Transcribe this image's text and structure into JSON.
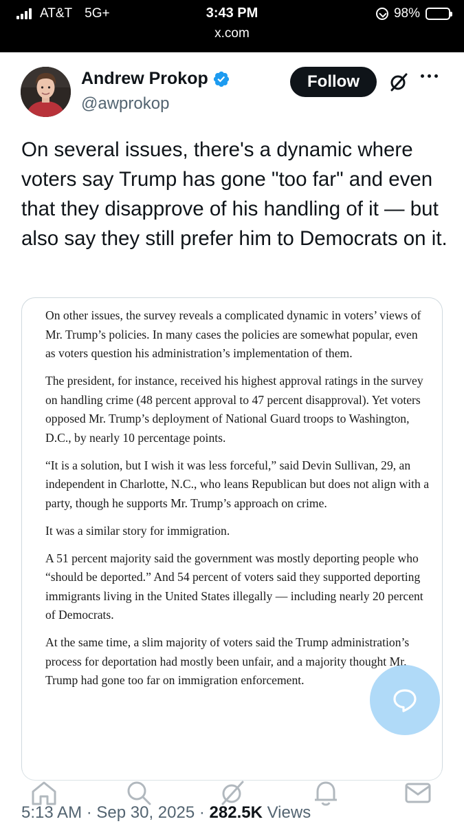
{
  "status_bar": {
    "carrier": "AT&T",
    "network": "5G+",
    "time": "3:43 PM",
    "battery": "98%",
    "battery_level": 0.98
  },
  "url_bar": {
    "domain": "x.com"
  },
  "tweet": {
    "author_name": "Andrew Prokop",
    "author_handle": "@awprokop",
    "follow_label": "Follow",
    "text": "On several issues, there's a dynamic where voters say Trump has gone \"too far\" and even that they disapprove of his handling of it — but also say they still prefer him to Democrats on it.",
    "time": "5:13 AM",
    "date": "Sep 30, 2025",
    "views_count": "282.5K",
    "views_label": "Views"
  },
  "article_image": {
    "paragraphs": [
      "On other issues, the survey reveals a complicated dynamic in voters’ views of Mr. Trump’s policies. In many cases the policies are somewhat popular, even as voters question his administration’s implementation of them.",
      "The president, for instance, received his highest approval ratings in the survey on handling crime (48 percent approval to 47 percent disapproval). Yet voters opposed Mr. Trump’s deployment of National Guard troops to Washington, D.C., by nearly 10 percentage points.",
      "“It is a solution, but I wish it was less forceful,” said Devin Sullivan, 29, an independent in Charlotte, N.C., who leans Republican but does not align with a party, though he supports Mr. Trump’s approach on crime.",
      "It was a similar story for immigration.",
      "A 51 percent majority said the government was mostly deporting people who “should be deported.” And 54 percent of voters said they supported deporting immigrants living in the United States illegally — including nearly 20 percent of Democrats.",
      "At the same time, a slim majority of voters said the Trump administration’s process for deportation had mostly been unfair, and a majority thought Mr. Trump had gone too far on immigration enforcement."
    ]
  },
  "icons": {
    "signal": "signal-bars-icon",
    "orientation_lock": "orientation-lock-icon",
    "battery": "battery-icon",
    "verified": "verified-badge-icon",
    "grok": "grok-icon",
    "more": "more-options-icon",
    "compose": "compose-reply-icon",
    "nav": [
      "home-icon",
      "search-icon",
      "grok-icon",
      "notifications-icon",
      "messages-icon"
    ]
  },
  "colors": {
    "verified": "#1d9bf0",
    "follow_bg": "#0f1419",
    "secondary_text": "#536471",
    "fab": "#96cdf5"
  }
}
